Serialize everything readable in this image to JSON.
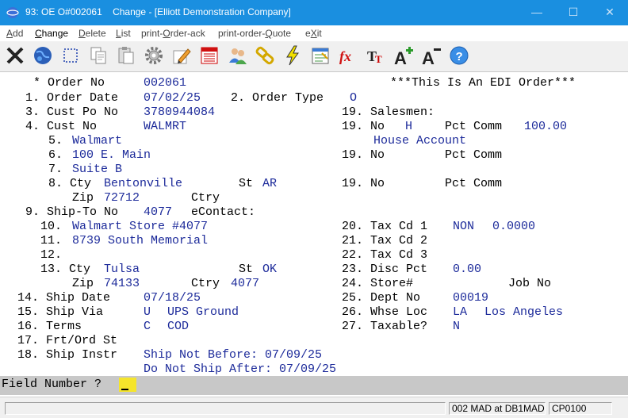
{
  "window": {
    "title": "93: OE O#002061    Change - [Elliott Demonstration Company]",
    "minimize": "—",
    "maximize": "☐",
    "close": "✕"
  },
  "menu": {
    "items": [
      {
        "ul": "A",
        "rest": "dd"
      },
      {
        "ul": "C",
        "rest": "hange"
      },
      {
        "ul": "D",
        "rest": "elete"
      },
      {
        "ul": "L",
        "rest": "ist"
      },
      {
        "pre": "print-",
        "ul": "O",
        "rest": "rder-ack"
      },
      {
        "pre": "print-order-",
        "ul": "Q",
        "rest": "uote"
      },
      {
        "pre": "e",
        "ul": "X",
        "rest": "it"
      }
    ]
  },
  "toolbar": {
    "buttons": [
      "close-x-icon",
      "globe-icon",
      "select-box-icon",
      "copy-icon",
      "paste-icon",
      "gear-icon",
      "edit-pencil-icon",
      "calendar-list-icon",
      "users-icon",
      "links-icon",
      "lightning-icon",
      "spreadsheet-icon",
      "function-icon",
      "font-size-icon",
      "font-increase-icon",
      "font-decrease-icon",
      "help-icon"
    ]
  },
  "form": {
    "order_no": {
      "label": "* Order No",
      "value": "002061"
    },
    "edi_banner": "***This Is An EDI Order***",
    "order_date": {
      "label": "1. Order Date",
      "value": "07/02/25"
    },
    "order_type": {
      "label": "2. Order Type",
      "value": "O"
    },
    "cust_po": {
      "label": "3. Cust Po No",
      "value": "3780944084"
    },
    "cust_no": {
      "label": "4. Cust No",
      "value": "WALMRT"
    },
    "name": {
      "label": "5.",
      "value": "Walmart"
    },
    "addr1": {
      "label": "6.",
      "value": "100 E. Main"
    },
    "addr2": {
      "label": "7.",
      "value": "Suite B"
    },
    "bill_city": {
      "label": "8. Cty",
      "value": "Bentonville",
      "st_label": "St",
      "st_value": "AR"
    },
    "bill_zip": {
      "label": "Zip",
      "value": "72712",
      "ctry_label": "Ctry",
      "ctry_value": ""
    },
    "ship_to": {
      "label": "9. Ship-To No",
      "value": "4077",
      "econtact": "eContact:"
    },
    "ship_name": {
      "label": "10.",
      "value": "Walmart Store #4077"
    },
    "ship_addr1": {
      "label": "11.",
      "value": "8739 South Memorial"
    },
    "ship_addr2": {
      "label": "12.",
      "value": ""
    },
    "ship_city": {
      "label": "13. Cty",
      "value": "Tulsa",
      "st_label": "St",
      "st_value": "OK"
    },
    "ship_zip": {
      "label": "Zip",
      "value": "74133",
      "ctry_label": "Ctry",
      "ctry_value": "4077"
    },
    "ship_date": {
      "label": "14. Ship Date",
      "value": "07/18/25"
    },
    "ship_via": {
      "label": "15. Ship Via",
      "code": "U",
      "value": "UPS Ground"
    },
    "terms": {
      "label": "16. Terms",
      "code": "C",
      "value": "COD"
    },
    "frt": {
      "label": "17. Frt/Ord St",
      "value": ""
    },
    "ship_instr": {
      "label": "18. Ship Instr",
      "line1": "Ship Not Before: 07/09/25",
      "line2": "Do Not Ship After: 07/09/25"
    },
    "salesmen": {
      "label": "19. Salesmen:"
    },
    "sales1": {
      "label": "19. No",
      "no": "H",
      "pct_label": "Pct Comm",
      "pct": "100.00",
      "name": "House Account"
    },
    "sales2": {
      "label": "19. No",
      "no": "",
      "pct_label": "Pct Comm",
      "pct": ""
    },
    "sales3": {
      "label": "19. No",
      "no": "",
      "pct_label": "Pct Comm",
      "pct": ""
    },
    "tax1": {
      "label": "20. Tax Cd 1",
      "code": "NON",
      "rate": "0.0000"
    },
    "tax2": {
      "label": "21. Tax Cd 2",
      "code": ""
    },
    "tax3": {
      "label": "22. Tax Cd 3",
      "code": ""
    },
    "disc": {
      "label": "23. Disc Pct",
      "value": "0.00"
    },
    "store": {
      "label": "24. Store#",
      "value": "",
      "job_label": "Job No",
      "job_value": ""
    },
    "dept": {
      "label": "25. Dept No",
      "value": "00019"
    },
    "whse": {
      "label": "26. Whse Loc",
      "code": "LA",
      "value": "Los Angeles"
    },
    "taxable": {
      "label": "27. Taxable?",
      "value": "N"
    }
  },
  "prompt": {
    "label": "Field Number ?"
  },
  "status": {
    "p1": "",
    "p2": "002 MAD at DB1MAD",
    "p3": "CP0100"
  }
}
